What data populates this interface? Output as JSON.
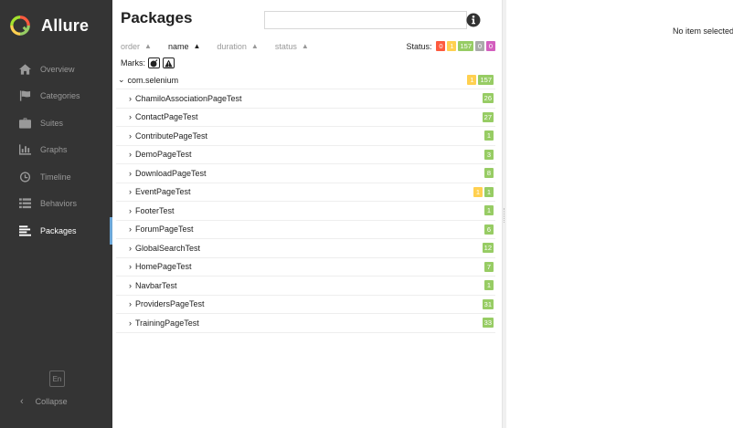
{
  "app": {
    "name": "Allure"
  },
  "sidebar": {
    "items": [
      {
        "label": "Overview",
        "icon": "home-icon",
        "active": false
      },
      {
        "label": "Categories",
        "icon": "flag-icon",
        "active": false
      },
      {
        "label": "Suites",
        "icon": "briefcase-icon",
        "active": false
      },
      {
        "label": "Graphs",
        "icon": "bar-chart-icon",
        "active": false
      },
      {
        "label": "Timeline",
        "icon": "clock-icon",
        "active": false
      },
      {
        "label": "Behaviors",
        "icon": "list-icon",
        "active": false
      },
      {
        "label": "Packages",
        "icon": "align-left-icon",
        "active": true
      }
    ],
    "language": "En",
    "collapse_label": "Collapse"
  },
  "main": {
    "title": "Packages",
    "search": {
      "value": "",
      "placeholder": ""
    },
    "sort": {
      "items": [
        {
          "label": "order",
          "active": false
        },
        {
          "label": "name",
          "active": true
        },
        {
          "label": "duration",
          "active": false
        },
        {
          "label": "status",
          "active": false
        }
      ]
    },
    "status": {
      "label": "Status:",
      "counts": {
        "failed": "0",
        "broken": "1",
        "passed": "157",
        "skipped": "0",
        "unknown": "0"
      }
    },
    "marks_label": "Marks:",
    "tree": {
      "root": {
        "name": "com.selenium",
        "broken": "1",
        "passed": "157"
      },
      "rows": [
        {
          "name": "ChamiloAssociationPageTest",
          "broken": "",
          "passed": "26"
        },
        {
          "name": "ContactPageTest",
          "broken": "",
          "passed": "27"
        },
        {
          "name": "ContributePageTest",
          "broken": "",
          "passed": "1"
        },
        {
          "name": "DemoPageTest",
          "broken": "",
          "passed": "3"
        },
        {
          "name": "DownloadPageTest",
          "broken": "",
          "passed": "8"
        },
        {
          "name": "EventPageTest",
          "broken": "1",
          "passed": "1"
        },
        {
          "name": "FooterTest",
          "broken": "",
          "passed": "1"
        },
        {
          "name": "ForumPageTest",
          "broken": "",
          "passed": "6"
        },
        {
          "name": "GlobalSearchTest",
          "broken": "",
          "passed": "12"
        },
        {
          "name": "HomePageTest",
          "broken": "",
          "passed": "7"
        },
        {
          "name": "NavbarTest",
          "broken": "",
          "passed": "1"
        },
        {
          "name": "ProvidersPageTest",
          "broken": "",
          "passed": "31"
        },
        {
          "name": "TrainingPageTest",
          "broken": "",
          "passed": "33"
        }
      ]
    }
  },
  "detail": {
    "empty_text": "No item selected"
  },
  "colors": {
    "sidebar_bg": "#343434",
    "active_indicator": "#6ca7d8",
    "failed": "#fd5a3e",
    "broken": "#ffd050",
    "passed": "#97cc64",
    "skipped": "#aaaaaa",
    "unknown": "#d35ebe"
  }
}
